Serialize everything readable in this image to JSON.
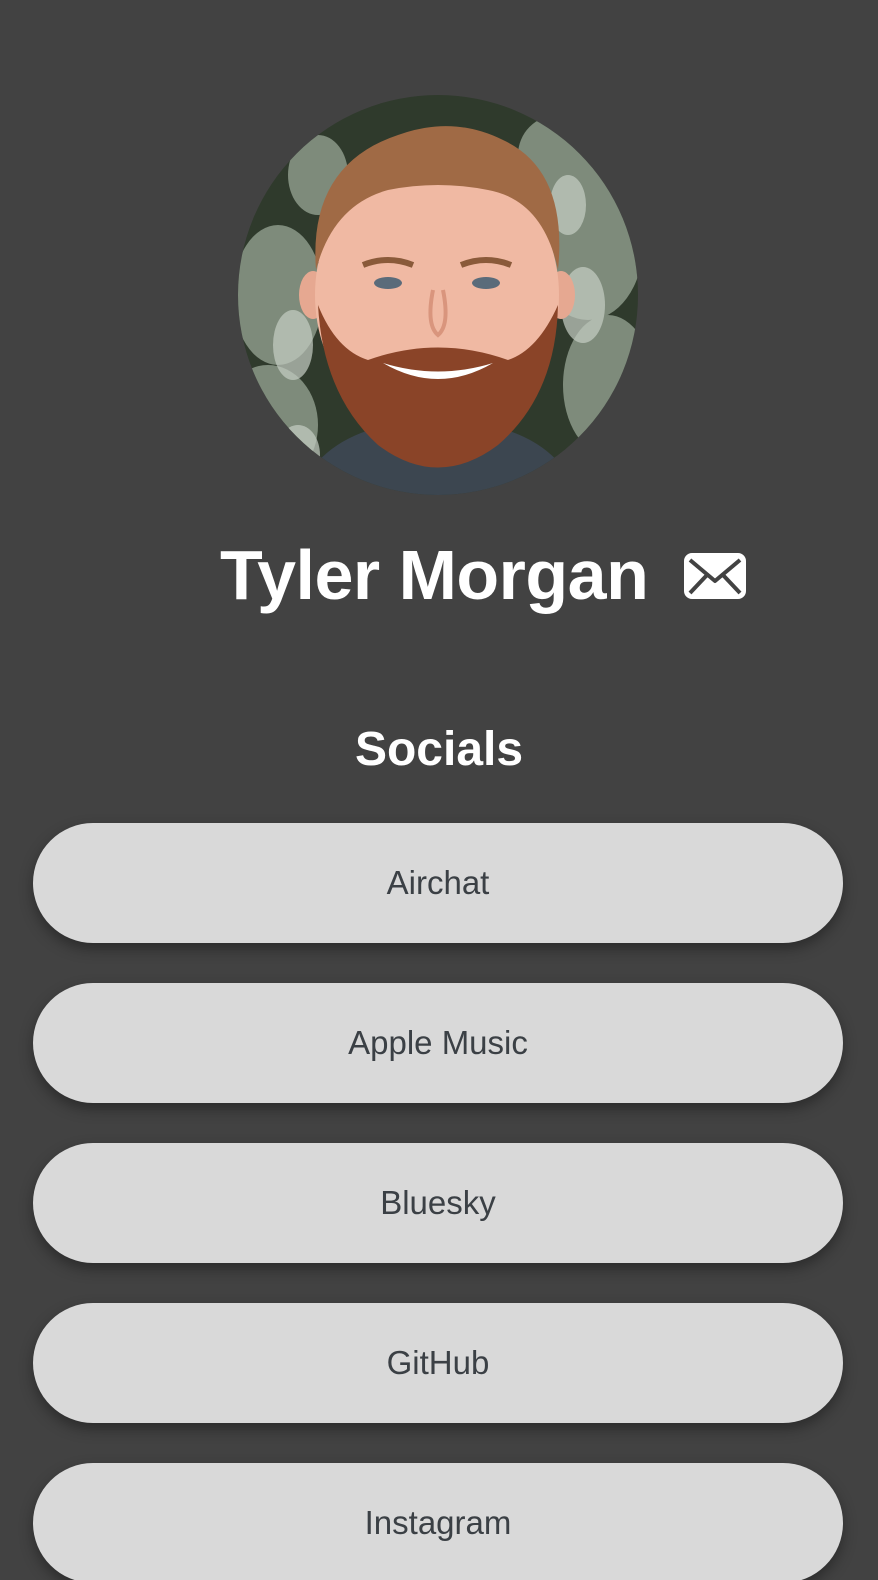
{
  "profile": {
    "name": "Tyler Morgan",
    "avatar_icon": "profile-photo",
    "mail_icon": "envelope-icon"
  },
  "socials": {
    "title": "Socials",
    "links": [
      {
        "label": "Airchat"
      },
      {
        "label": "Apple Music"
      },
      {
        "label": "Bluesky"
      },
      {
        "label": "GitHub"
      },
      {
        "label": "Instagram"
      }
    ]
  },
  "colors": {
    "background": "#424242",
    "button": "#d9d9d9",
    "button_text": "#3b4045",
    "heading_text": "#ffffff"
  }
}
